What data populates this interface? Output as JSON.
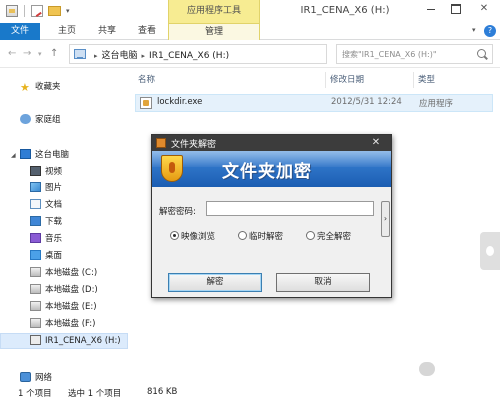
{
  "window": {
    "title": "IR1_CENA_X6 (H:)",
    "context_tab": "应用程序工具"
  },
  "ribbon": {
    "tabs": [
      "文件",
      "主页",
      "共享",
      "查看"
    ],
    "manage_tab": "管理"
  },
  "navbar": {
    "address": [
      "这台电脑",
      "IR1_CENA_X6 (H:)"
    ],
    "search_placeholder": "搜索\"IR1_CENA_X6 (H:)\""
  },
  "navpane": {
    "favorites": "收藏夹",
    "homegroup": "家庭组",
    "this_pc": "这台电脑",
    "items": [
      "视频",
      "图片",
      "文档",
      "下载",
      "音乐",
      "桌面",
      "本地磁盘 (C:)",
      "本地磁盘 (D:)",
      "本地磁盘 (E:)",
      "本地磁盘 (F:)",
      "IR1_CENA_X6 (H:)"
    ],
    "network": "网络"
  },
  "filelist": {
    "columns": [
      "名称",
      "修改日期",
      "类型"
    ],
    "rows": [
      {
        "name": "lockdir.exe",
        "modified": "2012/5/31 12:24",
        "type": "应用程序"
      }
    ]
  },
  "statusbar": {
    "count": "1 个项目",
    "selected": "选中 1 个项目",
    "size": "816 KB"
  },
  "dialog": {
    "title": "文件夹解密",
    "banner": "文件夹加密",
    "password_label": "解密密码:",
    "password_value": "",
    "options": [
      "映像浏览",
      "临时解密",
      "完全解密"
    ],
    "selected_option": "映像浏览",
    "ok_label": "解密",
    "cancel_label": "取消"
  }
}
